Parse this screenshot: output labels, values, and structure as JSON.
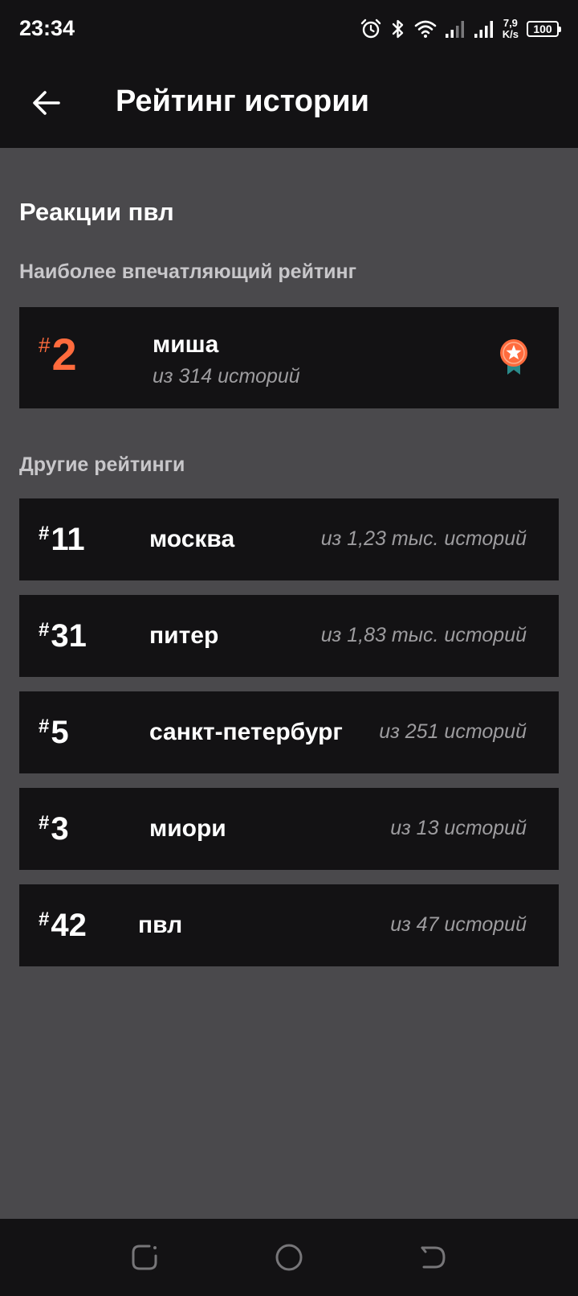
{
  "status_bar": {
    "time": "23:34",
    "net_speed_value": "7,9",
    "net_speed_unit": "K/s",
    "battery": "100",
    "icons": [
      "alarm-icon",
      "bluetooth-icon",
      "wifi-icon",
      "signal-icon",
      "signal-icon",
      "battery-icon"
    ]
  },
  "app_bar": {
    "back_icon": "arrow-left-icon",
    "title": "Рейтинг истории"
  },
  "section": {
    "title": "Реакции пвл"
  },
  "top_rating": {
    "heading": "Наиболее впечатляющий рейтинг",
    "hash": "#",
    "rank": "2",
    "name": "миша",
    "count": "из 314 историй",
    "icon": "medal-icon",
    "accent": "#ff6b3d"
  },
  "other_ratings": {
    "heading": "Другие рейтинги",
    "hash": "#",
    "items": [
      {
        "rank": "11",
        "name": "москва",
        "count": "из 1,23 тыс. историй"
      },
      {
        "rank": "31",
        "name": "питер",
        "count": "из 1,83 тыс. историй"
      },
      {
        "rank": "5",
        "name": "санкт-петербург",
        "count": "из 251 историй"
      },
      {
        "rank": "3",
        "name": "миори",
        "count": "из 13 историй"
      },
      {
        "rank": "42",
        "name": "пвл",
        "count": "из 47 историй"
      }
    ]
  },
  "nav_bar": {
    "icons": [
      "recents-icon",
      "home-icon",
      "back-nav-icon"
    ]
  }
}
